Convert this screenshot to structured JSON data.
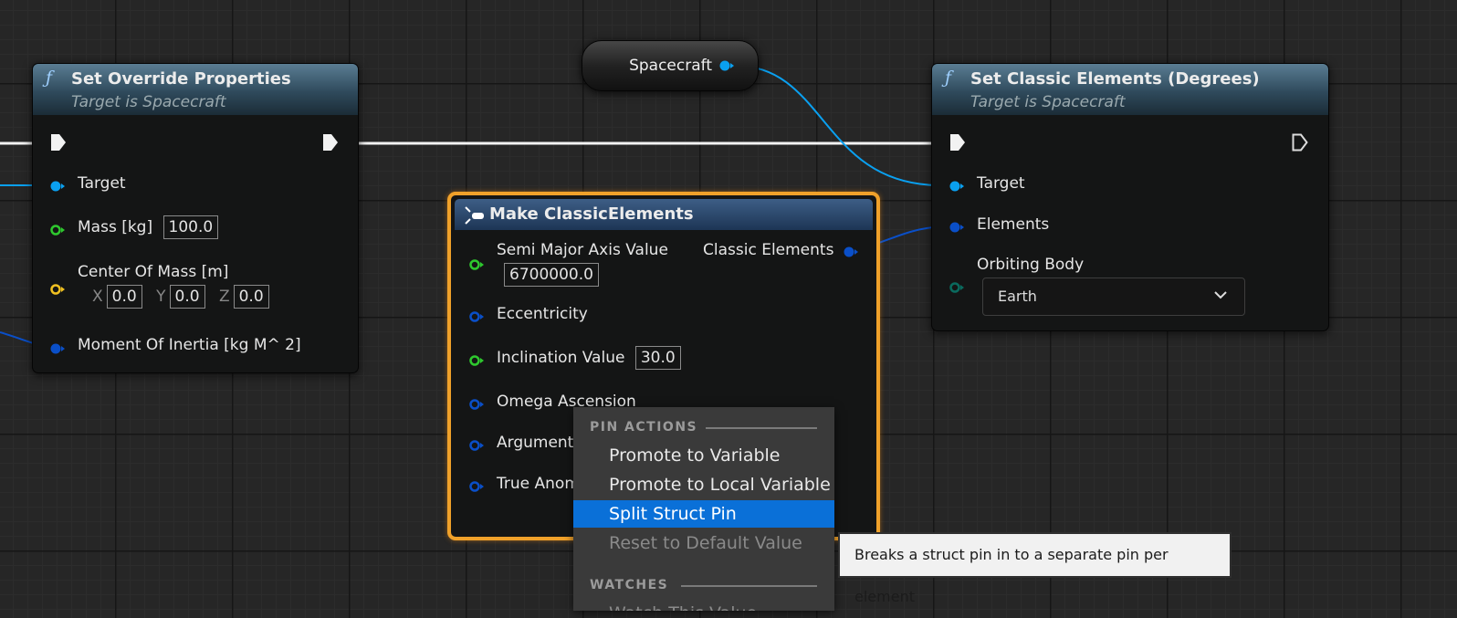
{
  "colors": {
    "object_pin": "#0aa0f0",
    "struct_pin": "#0a4fc8",
    "float_pin": "#2ec82e",
    "vector_pin": "#f0c020",
    "byte_pin": "#0a6a5e",
    "selection": "#0a70d8",
    "make_node_border": "#f0a12a"
  },
  "override_node": {
    "icon": "function-icon",
    "title": "Set Override Properties",
    "subtitle": "Target is Spacecraft",
    "pins": {
      "target": "Target",
      "mass": {
        "label": "Mass [kg]",
        "value": "100.0"
      },
      "center_of_mass": {
        "label": "Center Of Mass [m]",
        "x_label": "X",
        "x": "0.0",
        "y_label": "Y",
        "y": "0.0",
        "z_label": "Z",
        "z": "0.0"
      },
      "moment": "Moment Of Inertia [kg M^ 2]"
    }
  },
  "spacecraft_var": {
    "label": "Spacecraft"
  },
  "classic_node": {
    "icon": "function-icon",
    "title": "Set Classic Elements (Degrees)",
    "subtitle": "Target is Spacecraft",
    "pins": {
      "target": "Target",
      "elements": "Elements",
      "orbiting_body": "Orbiting Body",
      "orbiting_body_value": "Earth"
    }
  },
  "make_node": {
    "icon": "make-struct-icon",
    "title": "Make ClassicElements",
    "output": "Classic Elements",
    "pins": {
      "semi_major": {
        "label": "Semi Major Axis Value",
        "value": "6700000.0"
      },
      "eccentricity": "Eccentricity",
      "inclination": {
        "label": "Inclination Value",
        "value": "30.0"
      },
      "omega": "Omega Ascension",
      "argument": "Argument O",
      "true_anomaly": "True Anom"
    }
  },
  "context_menu": {
    "section_pin": "PIN ACTIONS",
    "promote": "Promote to Variable",
    "promote_local": "Promote to Local Variable",
    "split": "Split Struct Pin",
    "reset": "Reset to Default Value",
    "section_watch": "WATCHES",
    "watch": "Watch This Value"
  },
  "tooltip": "Breaks a struct pin in to a separate pin per element"
}
